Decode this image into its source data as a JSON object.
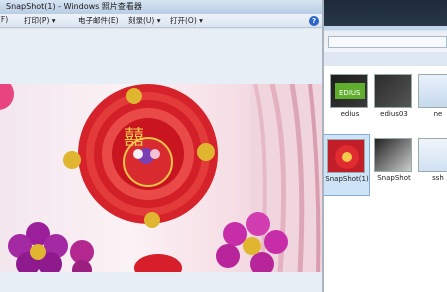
{
  "viewer": {
    "title": "SnapShot(1) - Windows 照片查看器",
    "help": "?",
    "menu": [
      {
        "label": "(F)"
      },
      {
        "label": "打印(P) ▾"
      },
      {
        "label": "电子邮件(E)"
      },
      {
        "label": "刻录(U) ▾"
      },
      {
        "label": "打开(O) ▾"
      }
    ]
  },
  "explorer": {
    "files": [
      {
        "label": "edius"
      },
      {
        "label": "edius03"
      },
      {
        "label": "ne"
      },
      {
        "label": "SnapShot(1)"
      },
      {
        "label": "SnapShot"
      },
      {
        "label": "ssh"
      }
    ]
  }
}
